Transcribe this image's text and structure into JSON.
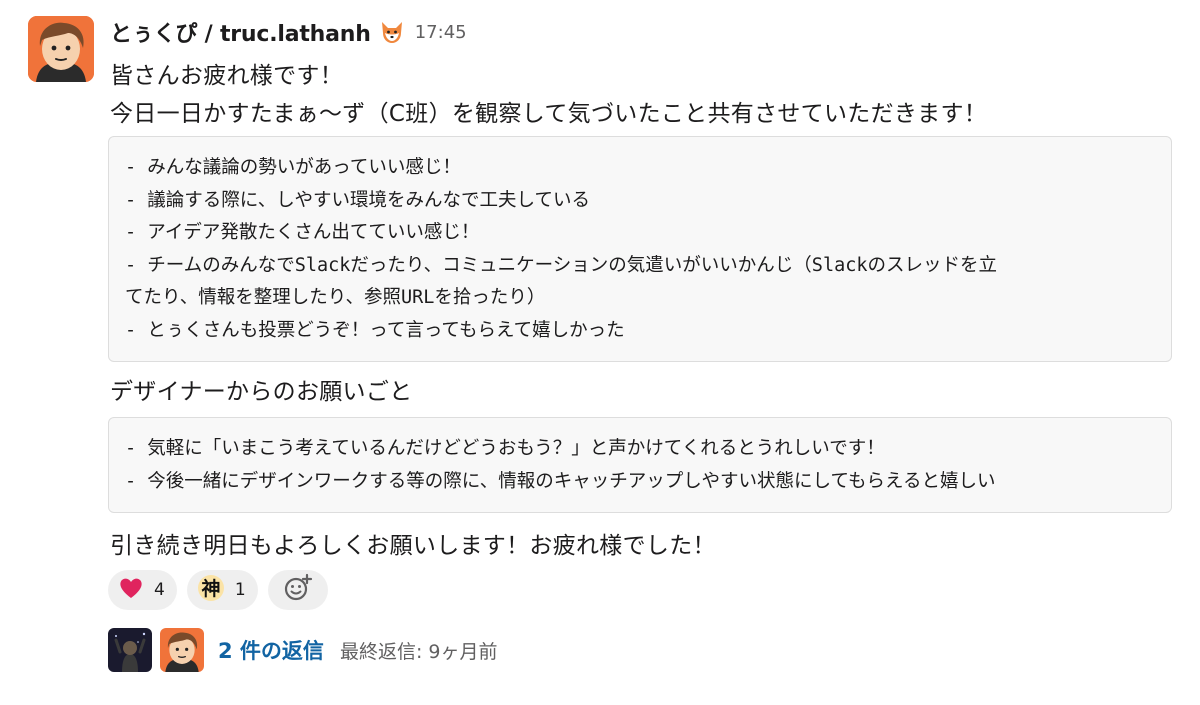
{
  "message": {
    "username": "とぅくぴ / truc.lathanh",
    "status_emoji": "fox-face-icon",
    "timestamp": "17:45",
    "lines": [
      "皆さんお疲れ様です！",
      "今日一日かすたまぁ〜ず（C班）を観察して気づいたこと共有させていただきます！"
    ],
    "code_block_1": [
      "- みんな議論の勢いがあっていい感じ！",
      "- 議論する際に、しやすい環境をみんなで工夫している",
      "- アイデア発散たくさん出てていい感じ！",
      "- チームのみんなでSlackだったり、コミュニケーションの気遣いがいいかんじ（Slackのスレッドを立",
      "てたり、情報を整理したり、参照URLを拾ったり）",
      "- とぅくさんも投票どうぞ！って言ってもらえて嬉しかった"
    ],
    "section_heading": "デザイナーからのお願いごと",
    "code_block_2": [
      "- 気軽に「いまこう考えているんだけどどうおもう？」と声かけてくれるとうれしいです！",
      "- 今後一緒にデザインワークする等の際に、情報のキャッチアップしやすい状態にしてもらえると嬉しい"
    ],
    "closing": "引き続き明日もよろしくお願いします！お疲れ様でした！"
  },
  "reactions": [
    {
      "icon": "heart-icon",
      "count": "4"
    },
    {
      "icon": "kami-kanji-icon",
      "glyph": "神",
      "count": "1"
    }
  ],
  "add_reaction_icon": "add-emoji-icon",
  "thread": {
    "reply_count": "2 件の返信",
    "last_reply": "最終返信: 9ヶ月前"
  },
  "colors": {
    "link": "#1264a3",
    "avatar_bg": "#f0733a",
    "reaction_bg": "#efefef",
    "code_bg": "#f8f8f8"
  }
}
